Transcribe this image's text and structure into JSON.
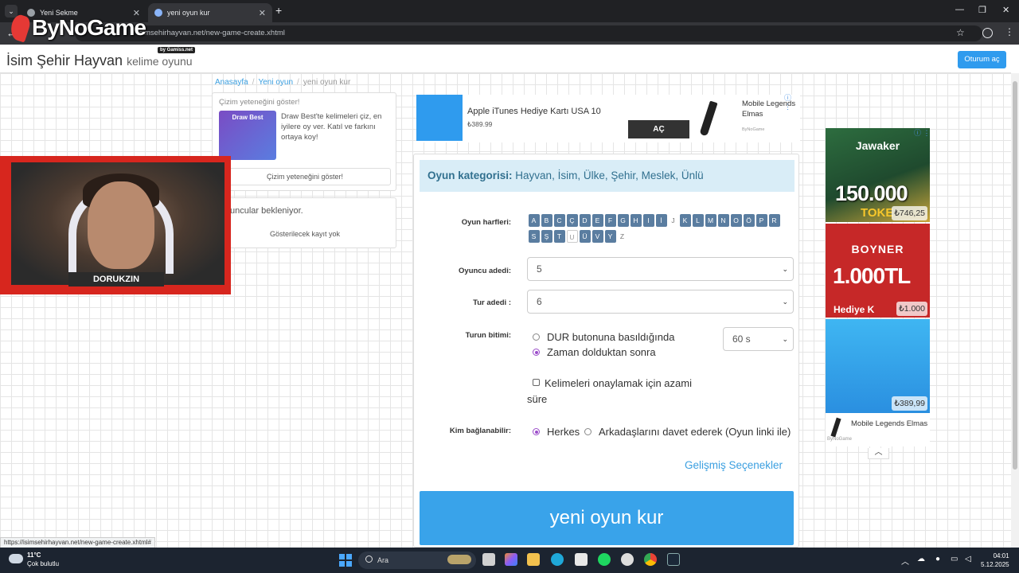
{
  "browser": {
    "tabs": [
      {
        "label": "Yeni Sekme"
      },
      {
        "label": "yeni oyun kur"
      }
    ],
    "url": "isimsehirhayvan.net/new-game-create.xhtml",
    "status_url": "https://isimsehirhayvan.net/new-game-create.xhtml#"
  },
  "overlay": {
    "logo_text": "ByNoGame",
    "logo_sub": "by Gamiss.net",
    "streamer_name": "DORUKZIN"
  },
  "site": {
    "title": "İsim Şehir Hayvan",
    "subtitle": "kelime oyunu",
    "login": "Oturum aç"
  },
  "breadcrumb": [
    "Anasayfa",
    "Yeni oyun",
    "yeni oyun kur"
  ],
  "draw_card": {
    "title": "Çizim yeteneğini göster!",
    "thumb_label": "Draw Best",
    "text": "Draw Best'te kelimeleri çiz, en iyilere oy ver. Katıl ve farkını ortaya koy!",
    "button": "Çizim yeteneğini göster!"
  },
  "players_card": {
    "waiting": "uncular bekleniyor.",
    "empty": "Gösterilecek kayıt yok"
  },
  "ad_top": {
    "title": "Apple iTunes Hediye Kartı USA 10",
    "price": "₺389.99",
    "button": "AÇ",
    "side_title": "Mobile Legends Elmas",
    "side_brand": "ByNoGame"
  },
  "form": {
    "category_label": "Oyun kategorisi:",
    "category_value": "Hayvan, İsim, Ülke, Şehir, Meslek, Ünlü",
    "letters_label": "Oyun harfleri:",
    "letters": [
      {
        "l": "A",
        "s": "on"
      },
      {
        "l": "B",
        "s": "on"
      },
      {
        "l": "C",
        "s": "on"
      },
      {
        "l": "Ç",
        "s": "on"
      },
      {
        "l": "D",
        "s": "on"
      },
      {
        "l": "E",
        "s": "on"
      },
      {
        "l": "F",
        "s": "on"
      },
      {
        "l": "G",
        "s": "on"
      },
      {
        "l": "H",
        "s": "on"
      },
      {
        "l": "I",
        "s": "on"
      },
      {
        "l": "İ",
        "s": "on"
      },
      {
        "l": "J",
        "s": "off"
      },
      {
        "l": "K",
        "s": "on"
      },
      {
        "l": "L",
        "s": "on"
      },
      {
        "l": "M",
        "s": "on"
      },
      {
        "l": "N",
        "s": "on"
      },
      {
        "l": "O",
        "s": "on"
      },
      {
        "l": "Ö",
        "s": "on"
      },
      {
        "l": "P",
        "s": "on"
      },
      {
        "l": "R",
        "s": "on"
      },
      {
        "l": "S",
        "s": "on"
      },
      {
        "l": "Ş",
        "s": "on"
      },
      {
        "l": "T",
        "s": "on"
      },
      {
        "l": "U",
        "s": "sel"
      },
      {
        "l": "Ü",
        "s": "on"
      },
      {
        "l": "V",
        "s": "on"
      },
      {
        "l": "Y",
        "s": "on"
      },
      {
        "l": "Z",
        "s": "off"
      }
    ],
    "players_label": "Oyuncu adedi:",
    "players_value": "5",
    "rounds_label": "Tur adedi :",
    "rounds_value": "6",
    "round_end_label": "Turun bitimi:",
    "round_end_options": [
      "DUR butonuna basıldığında",
      "Zaman dolduktan sonra"
    ],
    "round_end_selected": 1,
    "time_value": "60 s",
    "confirm_text": "Kelimeleri onaylamak için azami süre",
    "who_label": "Kim bağlanabilir:",
    "who_options": [
      "Herkes",
      "Arkadaşlarını davet ederek (Oyun linki ile)"
    ],
    "who_selected": 0,
    "advanced": "Gelişmiş Seçenekler",
    "submit": "yeni oyun kur"
  },
  "right_ads": [
    {
      "brand": "Jawaker",
      "big": "150.000",
      "sub": "TOKE",
      "price": "₺746,25"
    },
    {
      "brand": "BOYNER",
      "big": "1.000TL",
      "sub": "Hediye K",
      "price": "₺1.000"
    },
    {
      "price": "₺389,99"
    },
    {
      "title": "Mobile Legends Elmas",
      "brand": "ByNoGame"
    }
  ],
  "taskbar": {
    "temp": "11°C",
    "weather": "Çok bulutlu",
    "search": "Ara",
    "time": "04:01",
    "date": "5.12.2025"
  },
  "colors": {
    "accent": "#39a3ea",
    "category_bg": "#d9edf7",
    "letter_bg": "#5a7da0",
    "radio_on": "#9b4dca"
  }
}
